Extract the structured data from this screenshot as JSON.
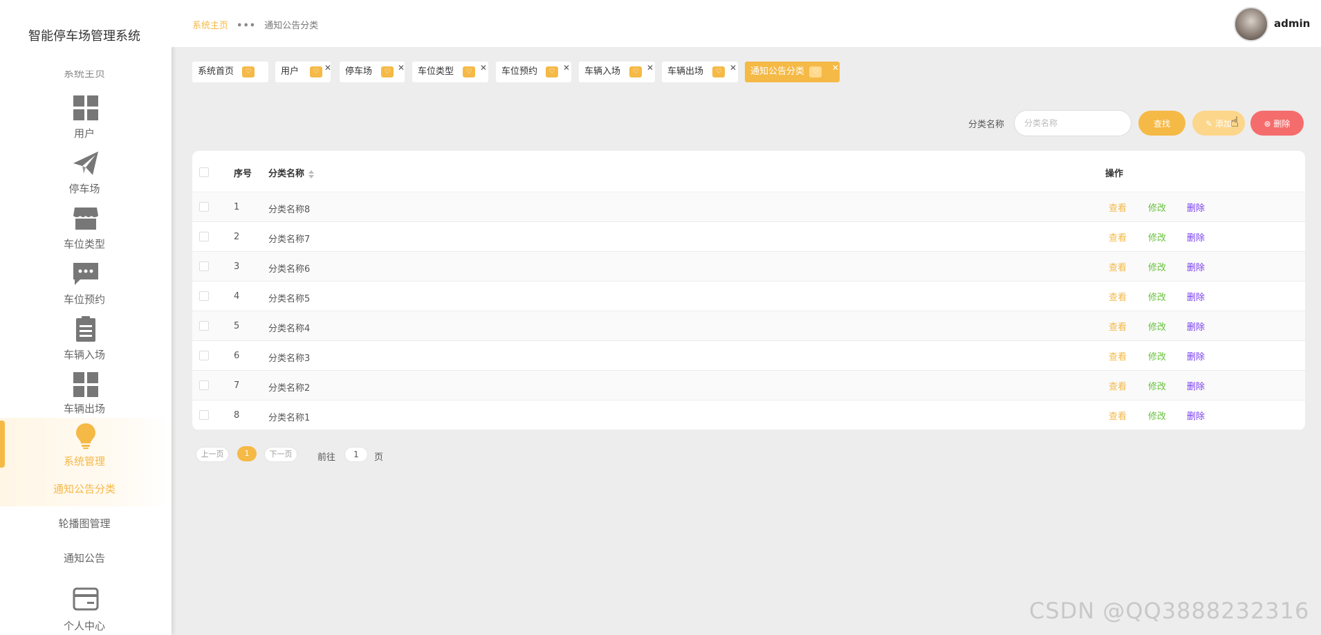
{
  "app": {
    "title": "智能停车场管理系统"
  },
  "sidebar": {
    "cut_label": "系统主页",
    "items": [
      {
        "label": "用户",
        "icon": "grid-icon"
      },
      {
        "label": "停车场",
        "icon": "paper-plane-icon"
      },
      {
        "label": "车位类型",
        "icon": "store-icon"
      },
      {
        "label": "车位预约",
        "icon": "chat-icon"
      },
      {
        "label": "车辆入场",
        "icon": "clipboard-icon"
      },
      {
        "label": "车辆出场",
        "icon": "grid-icon"
      },
      {
        "label": "系统管理",
        "icon": "bulb-icon"
      },
      {
        "label": "个人中心",
        "icon": "card-icon"
      }
    ],
    "submenu": [
      "通知公告分类",
      "轮播图管理",
      "通知公告"
    ]
  },
  "header": {
    "breadcrumb_home": "系统主页",
    "breadcrumb_current": "通知公告分类",
    "username": "admin"
  },
  "tags": [
    "系统首页",
    "用户",
    "停车场",
    "车位类型",
    "车位预约",
    "车辆入场",
    "车辆出场",
    "通知公告分类"
  ],
  "search": {
    "label": "分类名称",
    "placeholder": "分类名称",
    "find_label": "查找",
    "add_label": "添加",
    "delete_label": "删除"
  },
  "table": {
    "headers": {
      "index": "序号",
      "name": "分类名称",
      "ops": "操作"
    },
    "rows": [
      {
        "index": "1",
        "name": "分类名称8"
      },
      {
        "index": "2",
        "name": "分类名称7"
      },
      {
        "index": "3",
        "name": "分类名称6"
      },
      {
        "index": "4",
        "name": "分类名称5"
      },
      {
        "index": "5",
        "name": "分类名称4"
      },
      {
        "index": "6",
        "name": "分类名称3"
      },
      {
        "index": "7",
        "name": "分类名称2"
      },
      {
        "index": "8",
        "name": "分类名称1"
      }
    ],
    "actions": {
      "view": "查看",
      "edit": "修改",
      "delete": "删除"
    }
  },
  "pagination": {
    "prev": "上一页",
    "current": "1",
    "next": "下一页",
    "goto_prefix": "前往",
    "goto_value": "1",
    "goto_suffix": "页"
  },
  "watermark": "CSDN @QQ3888232316",
  "colors": {
    "accent": "#f5b946",
    "danger": "#f56c6c",
    "success": "#67c23a",
    "purple": "#7b3ff2"
  }
}
